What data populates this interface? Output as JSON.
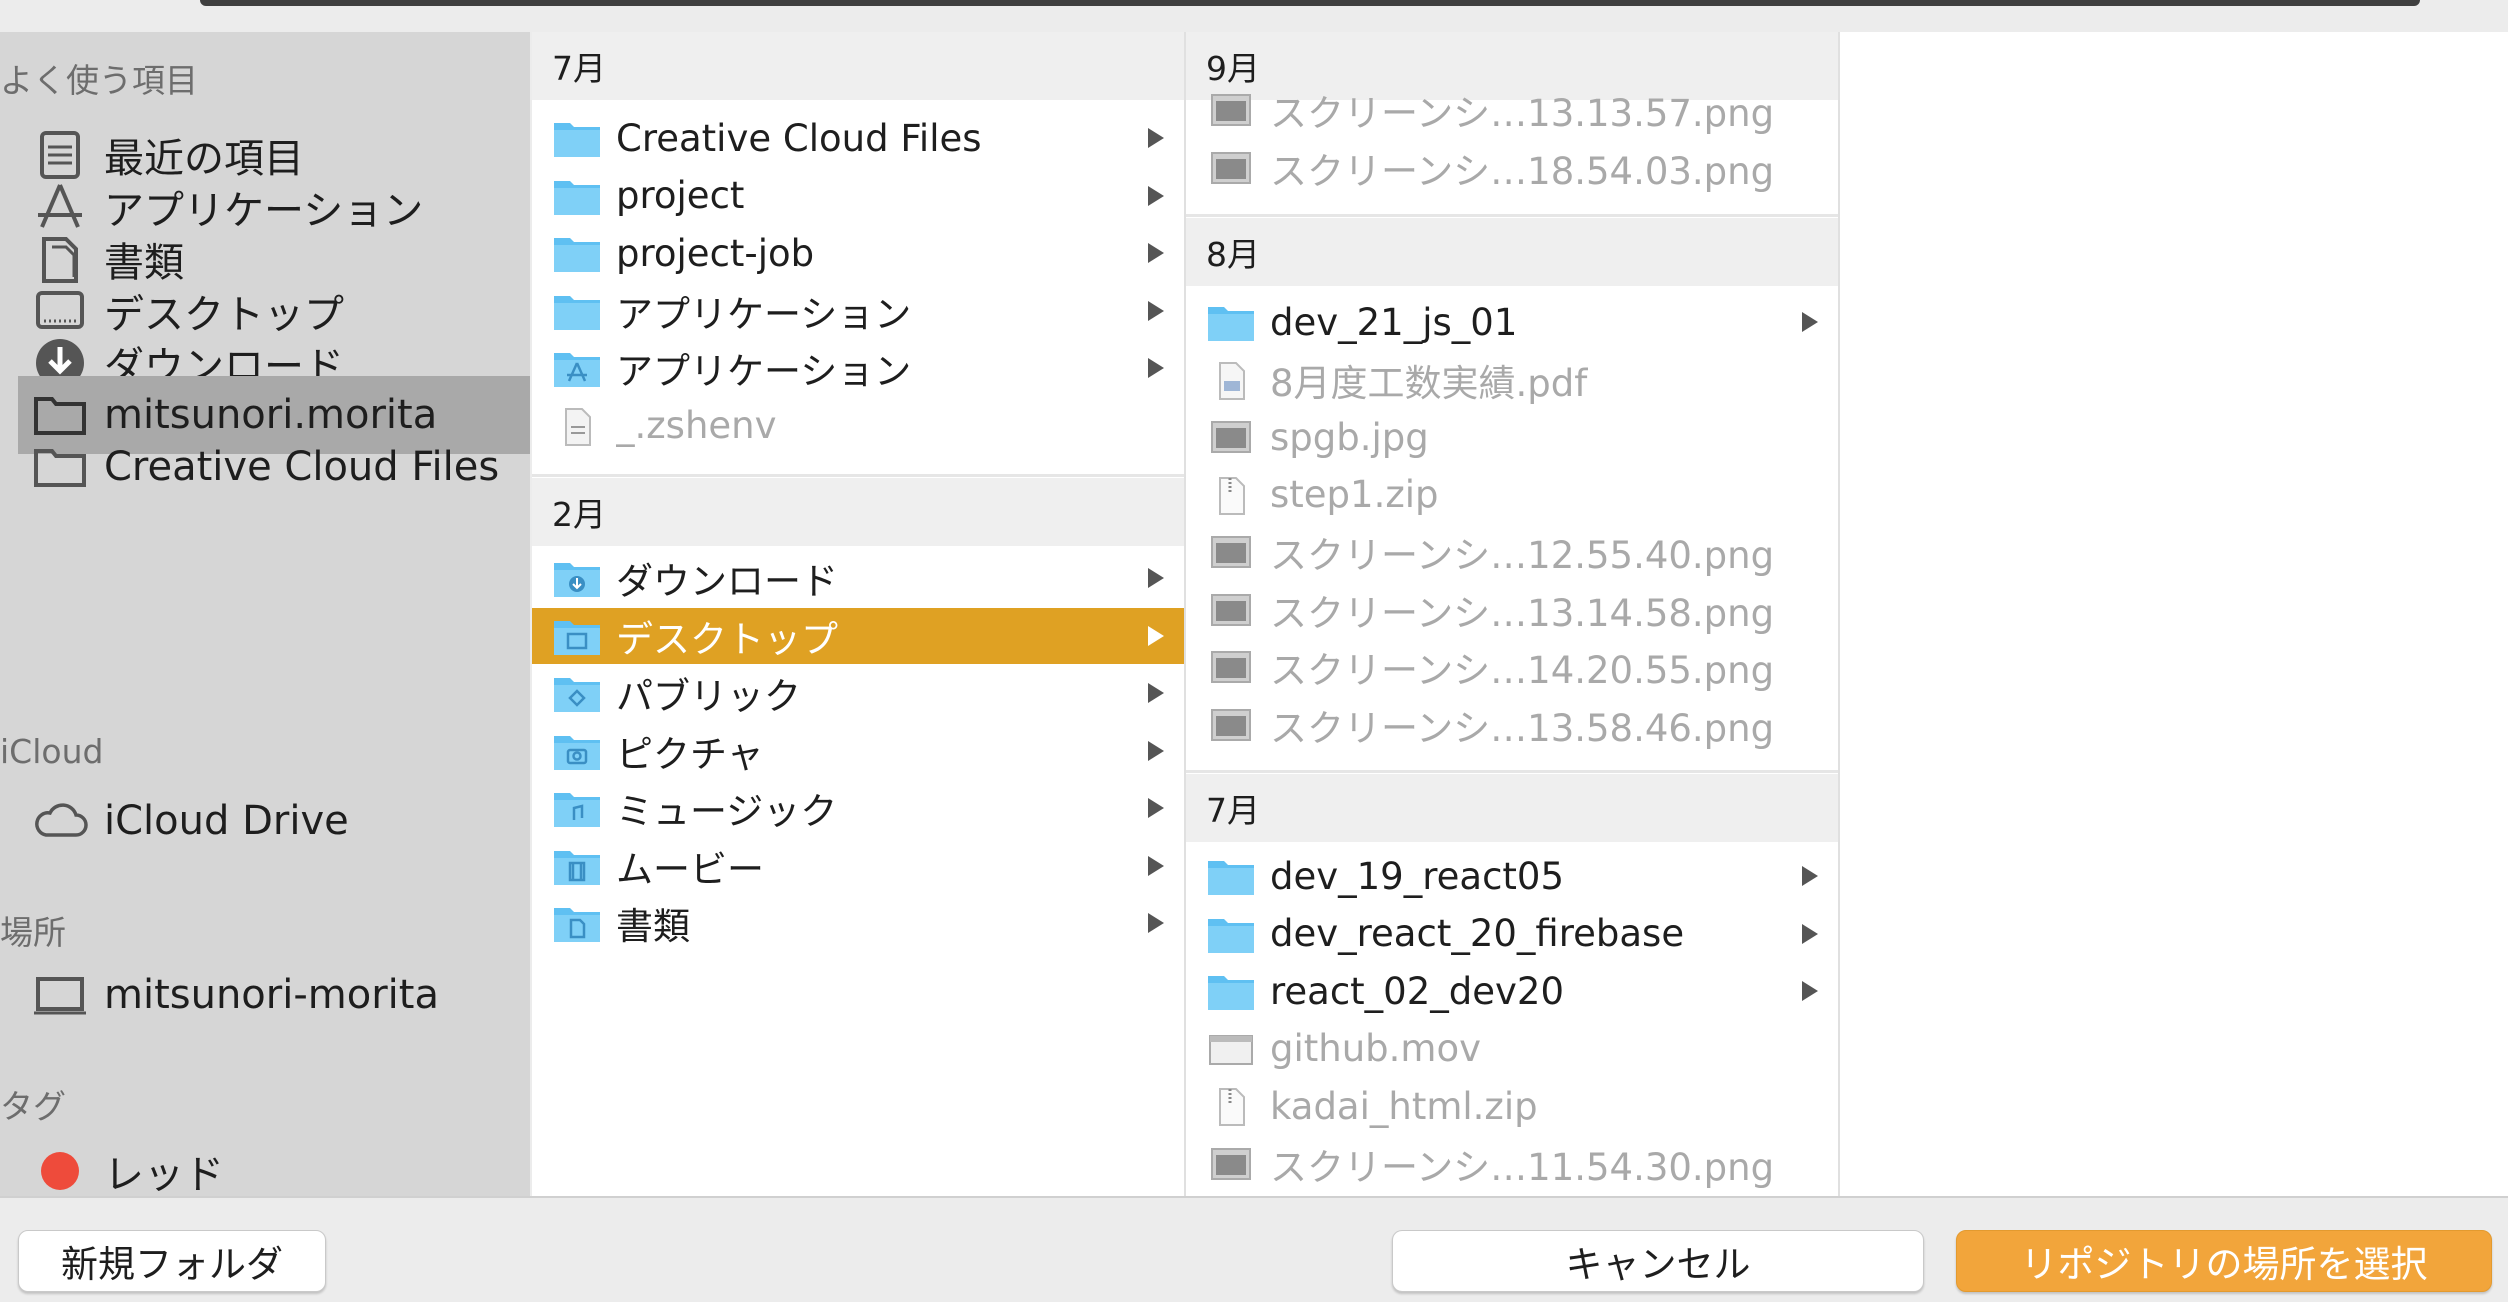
{
  "sidebar": {
    "sections": {
      "favorites": "よく使う項目",
      "icloud": "iCloud",
      "locations": "場所",
      "tags": "タグ"
    },
    "favorites": [
      {
        "label": "最近の項目",
        "icon": "recents-icon"
      },
      {
        "label": "アプリケーション",
        "icon": "applications-icon"
      },
      {
        "label": "書類",
        "icon": "documents-icon"
      },
      {
        "label": "デスクトップ",
        "icon": "desktop-icon"
      },
      {
        "label": "ダウンロード",
        "icon": "downloads-icon"
      },
      {
        "label": "mitsunori.morita",
        "icon": "home-folder-icon",
        "selected": true
      },
      {
        "label": "Creative Cloud Files",
        "icon": "folder-icon"
      }
    ],
    "icloud": [
      {
        "label": "iCloud Drive",
        "icon": "cloud-icon"
      }
    ],
    "locations": [
      {
        "label": "mitsunori-morita",
        "icon": "computer-icon"
      }
    ],
    "tags": [
      {
        "label": "レッド",
        "color": "#ee4b3b"
      }
    ]
  },
  "column1": {
    "groups": [
      {
        "header": "7月",
        "items": [
          {
            "label": "Creative Cloud Files",
            "type": "folder",
            "has_children": true
          },
          {
            "label": "project",
            "type": "folder",
            "has_children": true
          },
          {
            "label": "project-job",
            "type": "folder",
            "has_children": true
          },
          {
            "label": "アプリケーション",
            "type": "folder",
            "has_children": true
          },
          {
            "label": "アプリケーション",
            "type": "folder-apps",
            "has_children": true
          },
          {
            "label": "_.zshenv",
            "type": "file",
            "dimmed": true
          }
        ]
      },
      {
        "header": "2月",
        "items": [
          {
            "label": "ダウンロード",
            "type": "folder-downloads",
            "has_children": true
          },
          {
            "label": "デスクトップ",
            "type": "folder-desktop",
            "has_children": true,
            "selected": true
          },
          {
            "label": "パブリック",
            "type": "folder-public",
            "has_children": true
          },
          {
            "label": "ピクチャ",
            "type": "folder-pictures",
            "has_children": true
          },
          {
            "label": "ミュージック",
            "type": "folder-music",
            "has_children": true
          },
          {
            "label": "ムービー",
            "type": "folder-movies",
            "has_children": true
          },
          {
            "label": "書類",
            "type": "folder-documents",
            "has_children": true
          }
        ]
      }
    ]
  },
  "column2": {
    "groups": [
      {
        "header": "9月",
        "items": [
          {
            "label": "スクリーンシ…13.13.57.png",
            "type": "image",
            "dimmed": true
          },
          {
            "label": "スクリーンシ…18.54.03.png",
            "type": "image",
            "dimmed": true
          }
        ]
      },
      {
        "header": "8月",
        "items": [
          {
            "label": "dev_21_js_01",
            "type": "folder",
            "has_children": true
          },
          {
            "label": "8月度工数実績.pdf",
            "type": "pdf",
            "dimmed": true
          },
          {
            "label": "spgb.jpg",
            "type": "image",
            "dimmed": true
          },
          {
            "label": "step1.zip",
            "type": "zip",
            "dimmed": true
          },
          {
            "label": "スクリーンシ…12.55.40.png",
            "type": "image",
            "dimmed": true
          },
          {
            "label": "スクリーンシ…13.14.58.png",
            "type": "image",
            "dimmed": true
          },
          {
            "label": "スクリーンシ…14.20.55.png",
            "type": "image",
            "dimmed": true
          },
          {
            "label": "スクリーンシ…13.58.46.png",
            "type": "image",
            "dimmed": true
          }
        ]
      },
      {
        "header": "7月",
        "items": [
          {
            "label": "dev_19_react05",
            "type": "folder",
            "has_children": true
          },
          {
            "label": "dev_react_20_firebase",
            "type": "folder",
            "has_children": true
          },
          {
            "label": "react_02_dev20",
            "type": "folder",
            "has_children": true
          },
          {
            "label": "github.mov",
            "type": "movie",
            "dimmed": true
          },
          {
            "label": "kadai_html.zip",
            "type": "zip",
            "dimmed": true
          },
          {
            "label": "スクリーンシ…11.54.30.png",
            "type": "image",
            "dimmed": true
          }
        ]
      }
    ]
  },
  "buttons": {
    "new_folder": "新規フォルダ",
    "cancel": "キャンセル",
    "select": "リポジトリの場所を選択"
  },
  "colors": {
    "selection": "#dfa123",
    "primary_button": "#f2a53b",
    "folder": "#5fc0f2"
  }
}
